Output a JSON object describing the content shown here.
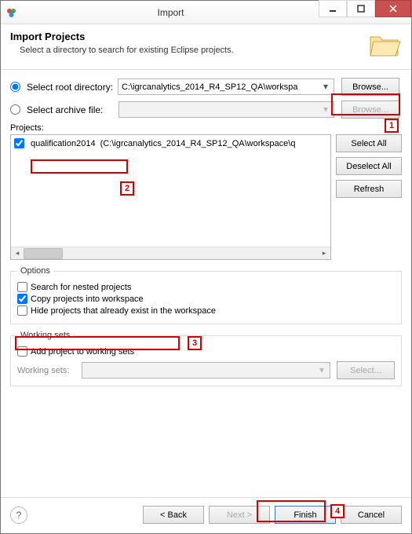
{
  "window": {
    "title": "Import"
  },
  "header": {
    "title": "Import Projects",
    "subtitle": "Select a directory to search for existing Eclipse projects."
  },
  "source": {
    "root_label": "Select root directory:",
    "archive_label": "Select archive file:",
    "root_value": "C:\\igrcanalytics_2014_R4_SP12_QA\\workspa",
    "archive_value": "",
    "browse_label": "Browse...",
    "browse2_label": "Browse..."
  },
  "projects": {
    "label": "Projects:",
    "items": [
      {
        "name": "qualification2014",
        "path": "(C:\\igrcanalytics_2014_R4_SP12_QA\\workspace\\q",
        "checked": true
      }
    ],
    "btn_select_all": "Select All",
    "btn_deselect_all": "Deselect All",
    "btn_refresh": "Refresh"
  },
  "options": {
    "legend": "Options",
    "nested": "Search for nested projects",
    "copy": "Copy projects into workspace",
    "hide": "Hide projects that already exist in the workspace"
  },
  "working_sets": {
    "legend": "Working sets",
    "add": "Add project to working sets",
    "label": "Working sets:",
    "select_btn": "Select..."
  },
  "footer": {
    "back": "< Back",
    "next": "Next >",
    "finish": "Finish",
    "cancel": "Cancel"
  },
  "callouts": {
    "c1": "1",
    "c2": "2",
    "c3": "3",
    "c4": "4"
  }
}
